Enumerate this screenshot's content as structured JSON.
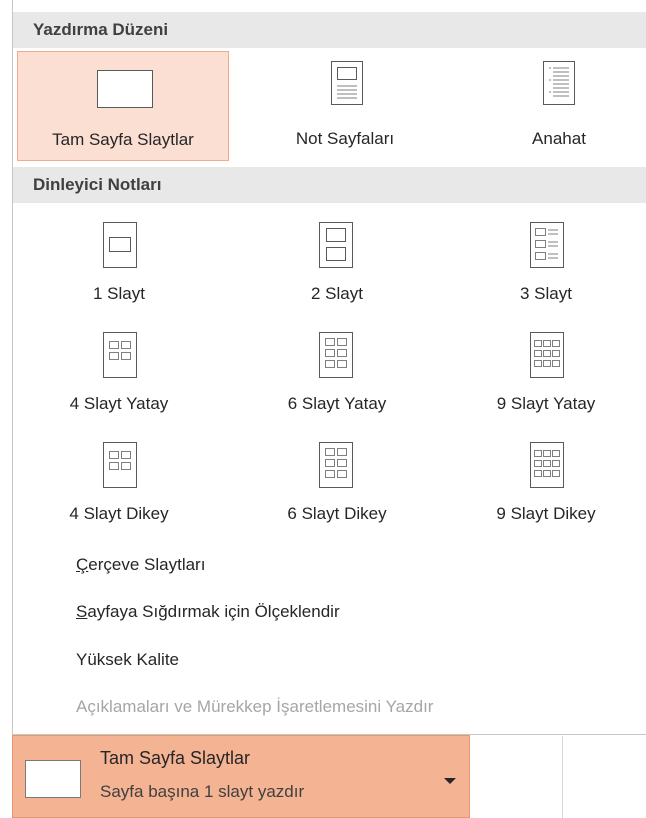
{
  "print_layout": {
    "heading": "Yazdırma Düzeni",
    "options": [
      {
        "label": "Tam Sayfa Slaytlar",
        "icon": "full-page-slide-icon",
        "selected": true
      },
      {
        "label": "Not Sayfaları",
        "icon": "notes-page-icon",
        "selected": false
      },
      {
        "label": "Anahat",
        "icon": "outline-icon",
        "selected": false
      }
    ]
  },
  "handouts": {
    "heading": "Dinleyici Notları",
    "options": [
      {
        "label": "1 Slayt",
        "icon": "handout-1-icon"
      },
      {
        "label": "2 Slayt",
        "icon": "handout-2-icon"
      },
      {
        "label": "3 Slayt",
        "icon": "handout-3-icon"
      },
      {
        "label": "4 Slayt Yatay",
        "icon": "handout-4-horizontal-icon"
      },
      {
        "label": "6 Slayt Yatay",
        "icon": "handout-6-horizontal-icon"
      },
      {
        "label": "9 Slayt Yatay",
        "icon": "handout-9-horizontal-icon"
      },
      {
        "label": "4 Slayt Dikey",
        "icon": "handout-4-vertical-icon"
      },
      {
        "label": "6 Slayt Dikey",
        "icon": "handout-6-vertical-icon"
      },
      {
        "label": "9 Slayt Dikey",
        "icon": "handout-9-vertical-icon"
      }
    ]
  },
  "menu": {
    "frame_slides": {
      "accel": "Ç",
      "rest": "erçeve Slaytları"
    },
    "scale_to_fit": {
      "accel": "S",
      "rest": "ayfaya Sığdırmak için Ölçeklendir"
    },
    "high_quality": "Yüksek Kalite",
    "print_comments": "Açıklamaları ve Mürekkep İşaretlemesini Yazdır"
  },
  "dropdown": {
    "title": "Tam Sayfa Slaytlar",
    "subtitle": "Sayfa başına 1 slayt yazdır"
  },
  "colors": {
    "selected_bg": "#fcdfd3",
    "dropdown_bg": "#f4b393",
    "section_bg": "#e8e8e8",
    "disabled_text": "#a6a6a6"
  }
}
